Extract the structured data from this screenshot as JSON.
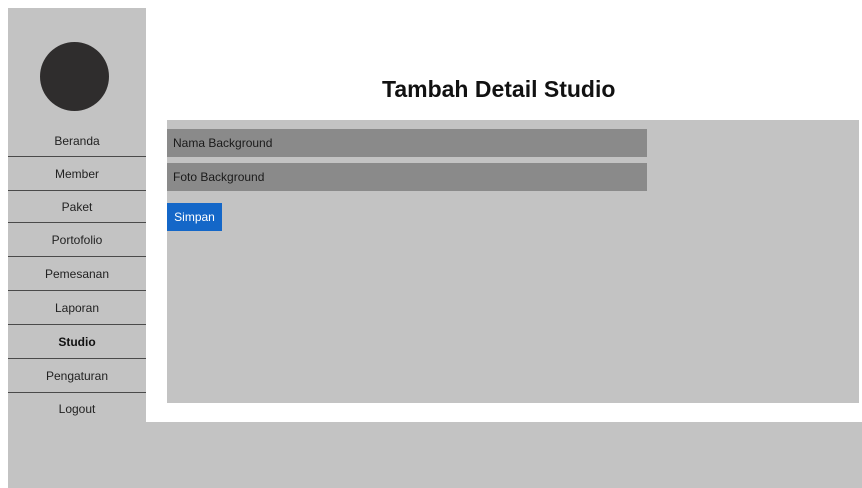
{
  "page": {
    "title": "Tambah Detail Studio"
  },
  "sidebar": {
    "items": [
      {
        "label": "Beranda",
        "active": false
      },
      {
        "label": "Member",
        "active": false
      },
      {
        "label": "Paket",
        "active": false
      },
      {
        "label": "Portofolio",
        "active": false
      },
      {
        "label": "Pemesanan",
        "active": false
      },
      {
        "label": "Laporan",
        "active": false
      },
      {
        "label": "Studio",
        "active": true
      },
      {
        "label": "Pengaturan",
        "active": false
      },
      {
        "label": "Logout",
        "active": false
      }
    ]
  },
  "form": {
    "nama_background": {
      "placeholder": "Nama Background",
      "value": ""
    },
    "foto_background": {
      "placeholder": "Foto Background",
      "value": ""
    },
    "save_label": "Simpan"
  },
  "colors": {
    "panel": "#c3c3c3",
    "field": "#8a8a8a",
    "button": "#1467c8",
    "avatar": "#2f2d2d"
  }
}
